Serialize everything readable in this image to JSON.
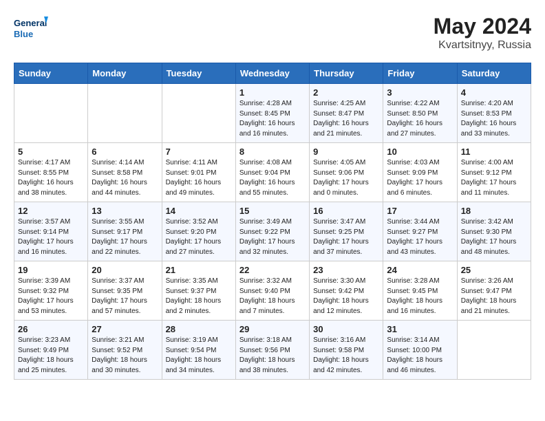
{
  "header": {
    "logo_line1": "General",
    "logo_line2": "Blue",
    "title": "May 2024",
    "location": "Kvartsitnyy, Russia"
  },
  "days_of_week": [
    "Sunday",
    "Monday",
    "Tuesday",
    "Wednesday",
    "Thursday",
    "Friday",
    "Saturday"
  ],
  "weeks": [
    [
      {
        "day": "",
        "info": ""
      },
      {
        "day": "",
        "info": ""
      },
      {
        "day": "",
        "info": ""
      },
      {
        "day": "1",
        "info": "Sunrise: 4:28 AM\nSunset: 8:45 PM\nDaylight: 16 hours and 16 minutes."
      },
      {
        "day": "2",
        "info": "Sunrise: 4:25 AM\nSunset: 8:47 PM\nDaylight: 16 hours and 21 minutes."
      },
      {
        "day": "3",
        "info": "Sunrise: 4:22 AM\nSunset: 8:50 PM\nDaylight: 16 hours and 27 minutes."
      },
      {
        "day": "4",
        "info": "Sunrise: 4:20 AM\nSunset: 8:53 PM\nDaylight: 16 hours and 33 minutes."
      }
    ],
    [
      {
        "day": "5",
        "info": "Sunrise: 4:17 AM\nSunset: 8:55 PM\nDaylight: 16 hours and 38 minutes."
      },
      {
        "day": "6",
        "info": "Sunrise: 4:14 AM\nSunset: 8:58 PM\nDaylight: 16 hours and 44 minutes."
      },
      {
        "day": "7",
        "info": "Sunrise: 4:11 AM\nSunset: 9:01 PM\nDaylight: 16 hours and 49 minutes."
      },
      {
        "day": "8",
        "info": "Sunrise: 4:08 AM\nSunset: 9:04 PM\nDaylight: 16 hours and 55 minutes."
      },
      {
        "day": "9",
        "info": "Sunrise: 4:05 AM\nSunset: 9:06 PM\nDaylight: 17 hours and 0 minutes."
      },
      {
        "day": "10",
        "info": "Sunrise: 4:03 AM\nSunset: 9:09 PM\nDaylight: 17 hours and 6 minutes."
      },
      {
        "day": "11",
        "info": "Sunrise: 4:00 AM\nSunset: 9:12 PM\nDaylight: 17 hours and 11 minutes."
      }
    ],
    [
      {
        "day": "12",
        "info": "Sunrise: 3:57 AM\nSunset: 9:14 PM\nDaylight: 17 hours and 16 minutes."
      },
      {
        "day": "13",
        "info": "Sunrise: 3:55 AM\nSunset: 9:17 PM\nDaylight: 17 hours and 22 minutes."
      },
      {
        "day": "14",
        "info": "Sunrise: 3:52 AM\nSunset: 9:20 PM\nDaylight: 17 hours and 27 minutes."
      },
      {
        "day": "15",
        "info": "Sunrise: 3:49 AM\nSunset: 9:22 PM\nDaylight: 17 hours and 32 minutes."
      },
      {
        "day": "16",
        "info": "Sunrise: 3:47 AM\nSunset: 9:25 PM\nDaylight: 17 hours and 37 minutes."
      },
      {
        "day": "17",
        "info": "Sunrise: 3:44 AM\nSunset: 9:27 PM\nDaylight: 17 hours and 43 minutes."
      },
      {
        "day": "18",
        "info": "Sunrise: 3:42 AM\nSunset: 9:30 PM\nDaylight: 17 hours and 48 minutes."
      }
    ],
    [
      {
        "day": "19",
        "info": "Sunrise: 3:39 AM\nSunset: 9:32 PM\nDaylight: 17 hours and 53 minutes."
      },
      {
        "day": "20",
        "info": "Sunrise: 3:37 AM\nSunset: 9:35 PM\nDaylight: 17 hours and 57 minutes."
      },
      {
        "day": "21",
        "info": "Sunrise: 3:35 AM\nSunset: 9:37 PM\nDaylight: 18 hours and 2 minutes."
      },
      {
        "day": "22",
        "info": "Sunrise: 3:32 AM\nSunset: 9:40 PM\nDaylight: 18 hours and 7 minutes."
      },
      {
        "day": "23",
        "info": "Sunrise: 3:30 AM\nSunset: 9:42 PM\nDaylight: 18 hours and 12 minutes."
      },
      {
        "day": "24",
        "info": "Sunrise: 3:28 AM\nSunset: 9:45 PM\nDaylight: 18 hours and 16 minutes."
      },
      {
        "day": "25",
        "info": "Sunrise: 3:26 AM\nSunset: 9:47 PM\nDaylight: 18 hours and 21 minutes."
      }
    ],
    [
      {
        "day": "26",
        "info": "Sunrise: 3:23 AM\nSunset: 9:49 PM\nDaylight: 18 hours and 25 minutes."
      },
      {
        "day": "27",
        "info": "Sunrise: 3:21 AM\nSunset: 9:52 PM\nDaylight: 18 hours and 30 minutes."
      },
      {
        "day": "28",
        "info": "Sunrise: 3:19 AM\nSunset: 9:54 PM\nDaylight: 18 hours and 34 minutes."
      },
      {
        "day": "29",
        "info": "Sunrise: 3:18 AM\nSunset: 9:56 PM\nDaylight: 18 hours and 38 minutes."
      },
      {
        "day": "30",
        "info": "Sunrise: 3:16 AM\nSunset: 9:58 PM\nDaylight: 18 hours and 42 minutes."
      },
      {
        "day": "31",
        "info": "Sunrise: 3:14 AM\nSunset: 10:00 PM\nDaylight: 18 hours and 46 minutes."
      },
      {
        "day": "",
        "info": ""
      }
    ]
  ]
}
